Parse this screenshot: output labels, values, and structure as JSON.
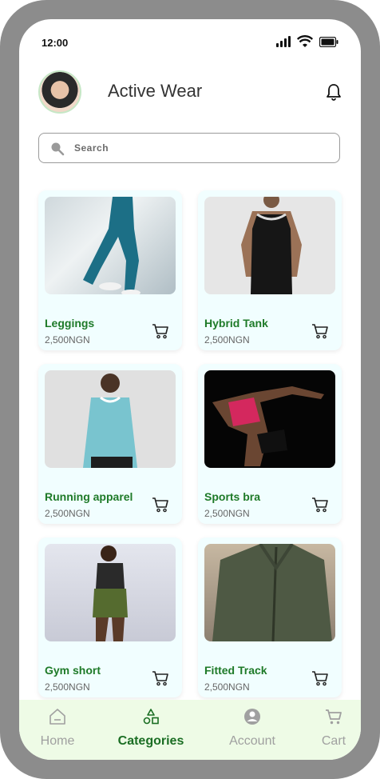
{
  "status": {
    "time": "12:00"
  },
  "header": {
    "title": "Active Wear"
  },
  "search": {
    "placeholder": "Search"
  },
  "products": [
    {
      "name": "Leggings",
      "price": "2,500NGN"
    },
    {
      "name": "Hybrid Tank",
      "price": "2,500NGN"
    },
    {
      "name": "Running apparel",
      "price": "2,500NGN"
    },
    {
      "name": "Sports bra",
      "price": "2,500NGN"
    },
    {
      "name": "Gym short",
      "price": "2,500NGN"
    },
    {
      "name": "Fitted Track",
      "price": "2,500NGN"
    }
  ],
  "tabs": [
    {
      "label": "Home",
      "icon": "home-icon"
    },
    {
      "label": "Categories",
      "icon": "categories-icon",
      "active": true
    },
    {
      "label": "Account",
      "icon": "account-icon"
    },
    {
      "label": "Cart",
      "icon": "cart-icon"
    }
  ],
  "colors": {
    "accent": "#1e7a28",
    "card_bg": "#f1feff",
    "tabbar_bg": "#eefbe6"
  }
}
